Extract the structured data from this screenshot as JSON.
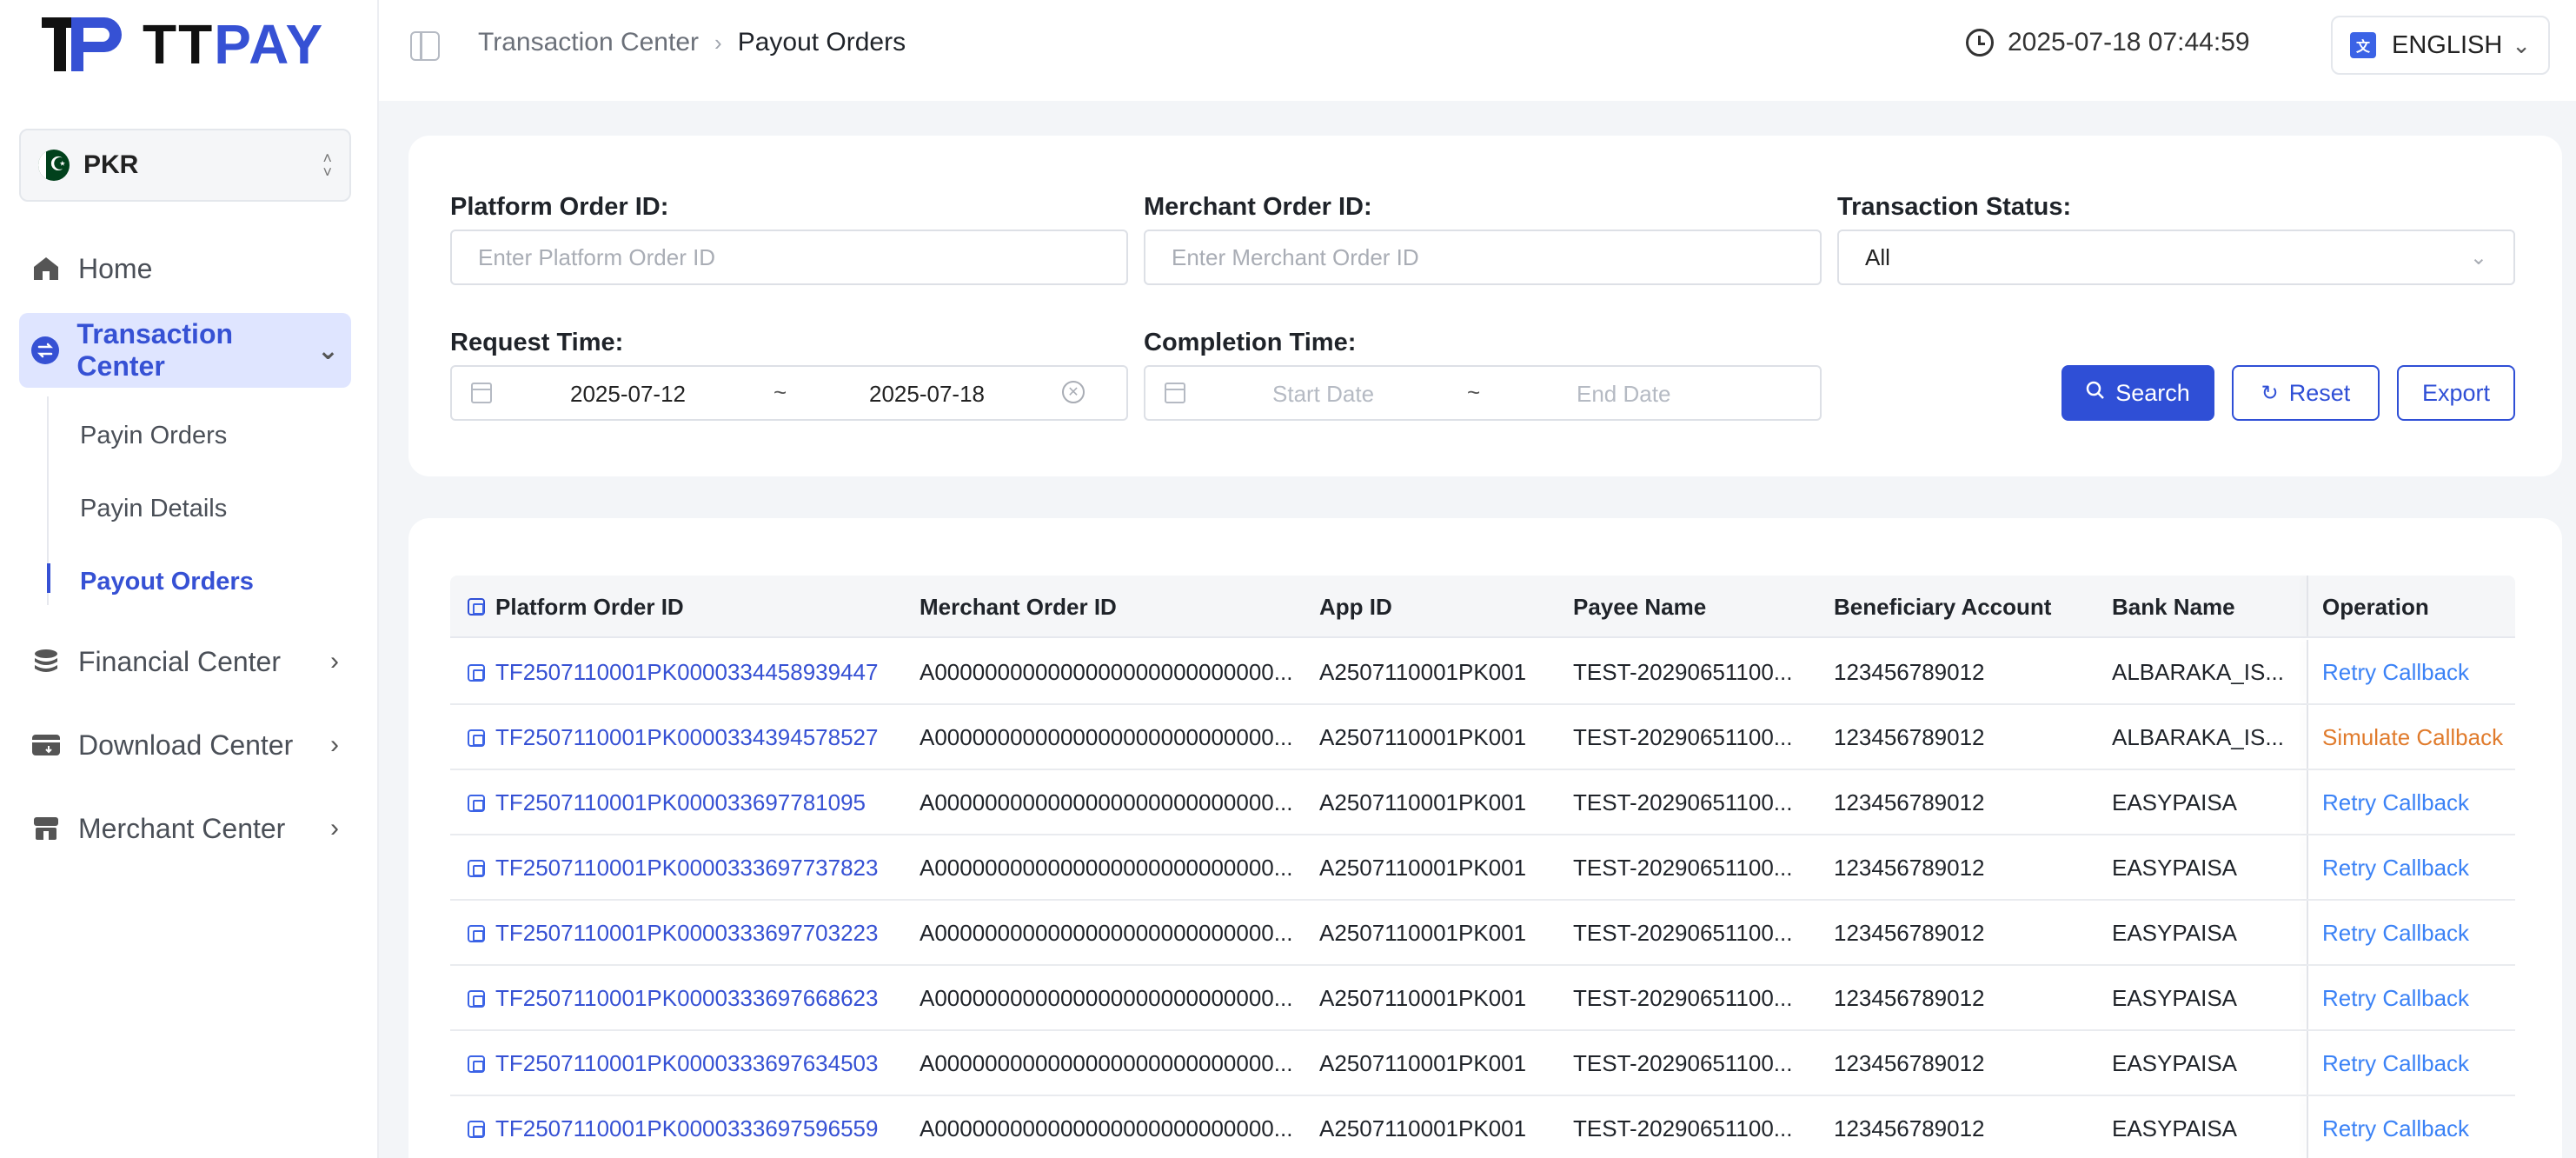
{
  "brand": {
    "name_part1": "TT",
    "name_part2": "PAY",
    "accent": "#3651d4"
  },
  "currency": {
    "code": "PKR",
    "flag": "pakistan-flag-icon"
  },
  "nav": {
    "home": "Home",
    "transaction_center": "Transaction Center",
    "payin_orders": "Payin Orders",
    "payin_details": "Payin Details",
    "payout_orders": "Payout Orders",
    "financial_center": "Financial Center",
    "download_center": "Download Center",
    "merchant_center": "Merchant Center"
  },
  "header": {
    "breadcrumb_parent": "Transaction Center",
    "breadcrumb_current": "Payout Orders",
    "datetime": "2025-07-18 07:44:59",
    "language": "ENGLISH"
  },
  "filters": {
    "platform_order_label": "Platform Order ID:",
    "platform_order_placeholder": "Enter Platform Order ID",
    "merchant_order_label": "Merchant Order ID:",
    "merchant_order_placeholder": "Enter Merchant Order ID",
    "status_label": "Transaction Status:",
    "status_value": "All",
    "request_time_label": "Request Time:",
    "request_start": "2025-07-12",
    "request_end": "2025-07-18",
    "completion_time_label": "Completion Time:",
    "completion_start_placeholder": "Start Date",
    "completion_end_placeholder": "End Date",
    "tilde": "~",
    "search_label": "Search",
    "reset_label": "Reset",
    "export_label": "Export"
  },
  "table": {
    "columns": [
      "Platform Order ID",
      "Merchant Order ID",
      "App ID",
      "Payee Name",
      "Beneficiary Account",
      "Bank Name",
      "Operation"
    ],
    "rows": [
      {
        "platform_id": "TF2507110001PK0000334458939447",
        "merchant_id": "A000000000000000000000000000...",
        "app_id": "A2507110001PK001",
        "payee": "TEST-20290651100...",
        "account": "123456789012",
        "bank": "ALBARAKA_IS...",
        "operation": "Retry Callback"
      },
      {
        "platform_id": "TF2507110001PK0000334394578527",
        "merchant_id": "A000000000000000000000000000...",
        "app_id": "A2507110001PK001",
        "payee": "TEST-20290651100...",
        "account": "123456789012",
        "bank": "ALBARAKA_IS...",
        "operation": "Simulate Callback"
      },
      {
        "platform_id": "TF2507110001PK000033697781095",
        "merchant_id": "A000000000000000000000000000...",
        "app_id": "A2507110001PK001",
        "payee": "TEST-20290651100...",
        "account": "123456789012",
        "bank": "EASYPAISA",
        "operation": "Retry Callback"
      },
      {
        "platform_id": "TF2507110001PK0000333697737823",
        "merchant_id": "A000000000000000000000000000...",
        "app_id": "A2507110001PK001",
        "payee": "TEST-20290651100...",
        "account": "123456789012",
        "bank": "EASYPAISA",
        "operation": "Retry Callback"
      },
      {
        "platform_id": "TF2507110001PK0000333697703223",
        "merchant_id": "A000000000000000000000000000...",
        "app_id": "A2507110001PK001",
        "payee": "TEST-20290651100...",
        "account": "123456789012",
        "bank": "EASYPAISA",
        "operation": "Retry Callback"
      },
      {
        "platform_id": "TF2507110001PK0000333697668623",
        "merchant_id": "A000000000000000000000000000...",
        "app_id": "A2507110001PK001",
        "payee": "TEST-20290651100...",
        "account": "123456789012",
        "bank": "EASYPAISA",
        "operation": "Retry Callback"
      },
      {
        "platform_id": "TF2507110001PK0000333697634503",
        "merchant_id": "A000000000000000000000000000...",
        "app_id": "A2507110001PK001",
        "payee": "TEST-20290651100...",
        "account": "123456789012",
        "bank": "EASYPAISA",
        "operation": "Retry Callback"
      },
      {
        "platform_id": "TF2507110001PK0000333697596559",
        "merchant_id": "A000000000000000000000000000...",
        "app_id": "A2507110001PK001",
        "payee": "TEST-20290651100...",
        "account": "123456789012",
        "bank": "EASYPAISA",
        "operation": "Retry Callback"
      }
    ]
  },
  "colors": {
    "primary": "#2f4fd6",
    "link": "#3651d4",
    "op_link": "#3b82f6",
    "warn_link": "#e07b2c"
  }
}
